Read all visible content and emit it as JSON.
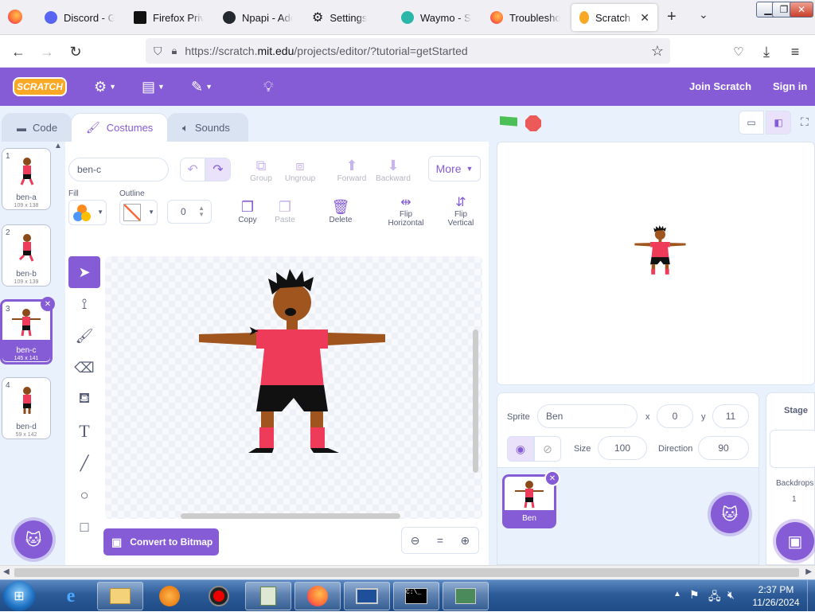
{
  "browser": {
    "tabs": [
      {
        "label": "Discord - Gro",
        "icon": "discord-icon",
        "color": "#5865f2"
      },
      {
        "label": "Firefox Privac",
        "icon": "mozilla-icon",
        "color": "#111111"
      },
      {
        "label": "Npapi - Adol",
        "icon": "github-icon",
        "color": "#24292f"
      },
      {
        "label": "Settings",
        "icon": "gear-icon",
        "color": "#3d3d3d"
      },
      {
        "label": "Waymo - Selt",
        "icon": "waymo-icon",
        "color": "#2bb7a7"
      },
      {
        "label": "Troubleshoo",
        "icon": "firefox-icon",
        "color": "#ff7139"
      },
      {
        "label": "Scratch - I",
        "icon": "scratch-icon",
        "color": "#f9a825"
      }
    ],
    "new_tab": "+",
    "url_prefix": "https://scratch.",
    "url_domain": "mit.edu",
    "url_suffix": "/projects/editor/?tutorial=getStarted"
  },
  "scratch": {
    "logo": "SCRATCH",
    "join": "Join Scratch",
    "signin": "Sign in",
    "accent": "#855cd6",
    "tabs": {
      "code": "Code",
      "costumes": "Costumes",
      "sounds": "Sounds"
    },
    "costumes": [
      {
        "num": "1",
        "name": "ben-a",
        "size": "109 x 138"
      },
      {
        "num": "2",
        "name": "ben-b",
        "size": "109 x 139"
      },
      {
        "num": "3",
        "name": "ben-c",
        "size": "145 x 141"
      },
      {
        "num": "4",
        "name": "ben-d",
        "size": "59 x 142"
      }
    ],
    "paint": {
      "costume_name": "ben-c",
      "fill_label": "Fill",
      "outline_label": "Outline",
      "outline_width": "0",
      "group": "Group",
      "ungroup": "Ungroup",
      "forward": "Forward",
      "backward": "Backward",
      "more": "More",
      "copy": "Copy",
      "paste": "Paste",
      "delete": "Delete",
      "flip_h1": "Flip",
      "flip_h2": "Horizontal",
      "flip_v1": "Flip",
      "flip_v2": "Vertical",
      "convert": "Convert to Bitmap",
      "zoom_reset": "="
    },
    "sprite": {
      "label": "Sprite",
      "name": "Ben",
      "x_label": "x",
      "x": "0",
      "y_label": "y",
      "y": "11",
      "size_label": "Size",
      "size": "100",
      "direction_label": "Direction",
      "direction": "90",
      "thumb_name": "Ben"
    },
    "stage_panel": {
      "title": "Stage",
      "backdrops_label": "Backdrops",
      "backdrops": "1"
    }
  },
  "taskbar": {
    "time": "2:37 PM",
    "date": "11/26/2024"
  }
}
